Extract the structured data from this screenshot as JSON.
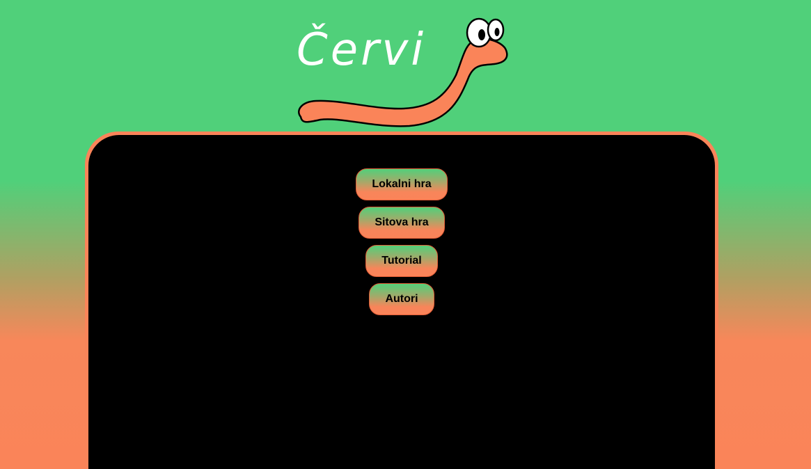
{
  "app": {
    "title": "Červi"
  },
  "logo": {
    "title": "Červi",
    "mascot_icon": "worm-mascot-icon"
  },
  "menu": {
    "items": [
      {
        "label": "Lokalni hra"
      },
      {
        "label": "Sitova hra"
      },
      {
        "label": "Tutorial"
      },
      {
        "label": "Autori"
      }
    ]
  },
  "colors": {
    "background_top": "#50d07a",
    "background_bottom": "#fa8459",
    "panel_border": "#fa8459",
    "panel_fill": "#000000",
    "worm": "#fa8459",
    "title_text": "#ffffff"
  }
}
